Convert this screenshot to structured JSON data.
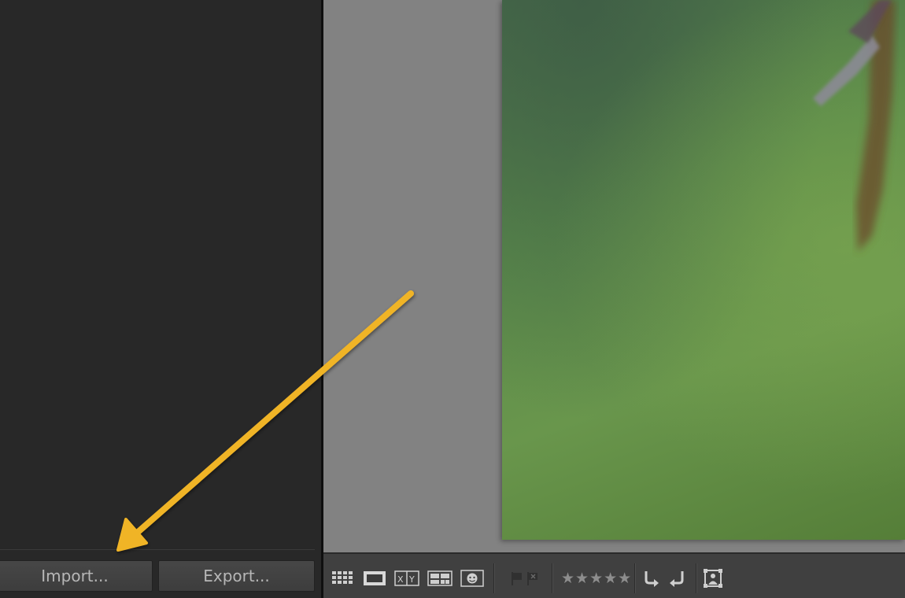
{
  "left_panel": {
    "import_label": "Import...",
    "export_label": "Export..."
  },
  "toolbar": {
    "view_modes": [
      "grid-view-icon",
      "loupe-view-icon",
      "compare-view-icon",
      "survey-view-icon",
      "people-view-icon"
    ],
    "compare_label": "XY",
    "stars": "★★★★★",
    "icons": [
      "flag-pick-icon",
      "flag-reject-icon",
      "rotate-left-icon",
      "rotate-right-icon",
      "crop-overlay-icon"
    ]
  },
  "colors": {
    "panel_bg": "#282828",
    "canvas_bg": "#828282",
    "toolbar_bg": "#404040",
    "annotation_arrow": "#f0b428"
  }
}
